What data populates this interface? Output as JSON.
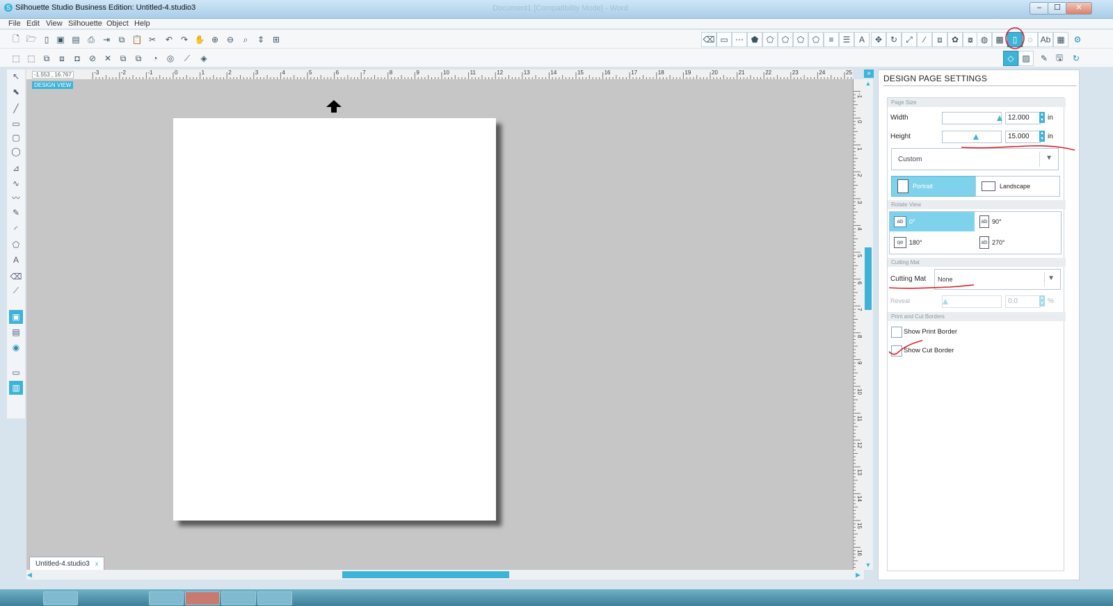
{
  "window": {
    "title": "Silhouette Studio Business Edition: Untitled-4.studio3",
    "background_title": "Document1 [Compatibility Mode] - Word",
    "minimize_label": "–",
    "maximize_label": "☐",
    "close_label": "✕"
  },
  "menu": [
    "File",
    "Edit",
    "View",
    "Silhouette",
    "Object",
    "Help"
  ],
  "canvas": {
    "view_label": "DESIGN VIEW",
    "coordinates": "-1.553 , 16.767",
    "ruler_top_labels": [
      "-3",
      "-2",
      "-1",
      "0",
      "1",
      "2",
      "3",
      "4",
      "5",
      "6",
      "7",
      "8",
      "9",
      "10",
      "11",
      "12",
      "13",
      "14",
      "15",
      "16",
      "17",
      "18",
      "19",
      "20",
      "21",
      "22",
      "23",
      "24",
      "25"
    ],
    "ruler_right_labels": [
      "-1",
      "0",
      "1",
      "2",
      "3",
      "4",
      "5",
      "6",
      "7",
      "8",
      "9",
      "10",
      "11",
      "12",
      "13",
      "14",
      "15",
      "16"
    ],
    "document_tab": "Untitled-4.studio3",
    "document_tab_close": "x"
  },
  "panel": {
    "title": "DESIGN PAGE SETTINGS",
    "expand_icon": "»",
    "page_size": {
      "header": "Page Size",
      "width_label": "Width",
      "width_value": "12.000",
      "height_label": "Height",
      "height_value": "15.000",
      "unit": "in",
      "preset": "Custom",
      "portrait_label": "Portrait",
      "landscape_label": "Landscape"
    },
    "rotate_view": {
      "header": "Rotate View",
      "options": [
        "0°",
        "90°",
        "180°",
        "270°"
      ],
      "selected": "0°"
    },
    "cutting_mat": {
      "header": "Cutting Mat",
      "label": "Cutting Mat",
      "value": "None",
      "reveal_label": "Reveal",
      "reveal_value": "0.0",
      "reveal_unit": "%"
    },
    "borders": {
      "header": "Print and Cut Borders",
      "show_print_border": "Show Print Border",
      "show_cut_border": "Show Cut Border"
    }
  },
  "colors": {
    "accent": "#3db3d7",
    "annotation_red": "#d8202a",
    "canvas_gray": "#c6c6c6"
  }
}
